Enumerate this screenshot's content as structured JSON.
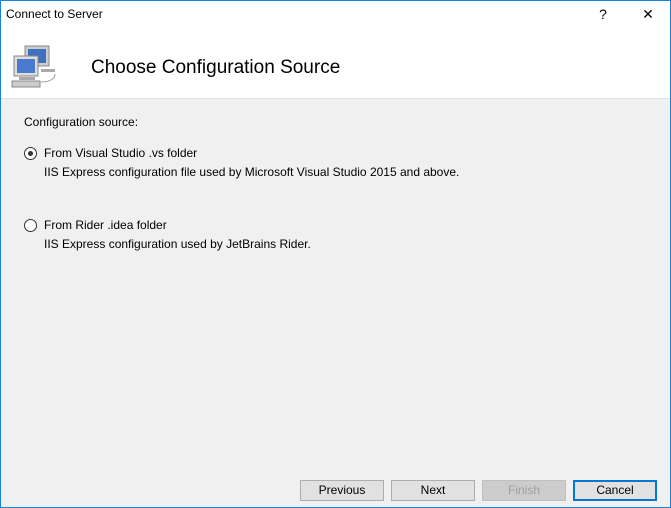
{
  "window": {
    "title": "Connect to Server",
    "help": "?",
    "close": "✕"
  },
  "header": {
    "title": "Choose Configuration Source"
  },
  "body": {
    "label": "Configuration source:",
    "options": [
      {
        "label": "From Visual Studio .vs folder",
        "description": "IIS Express configuration file used by Microsoft Visual Studio 2015 and above.",
        "selected": true
      },
      {
        "label": "From Rider .idea folder",
        "description": "IIS Express configuration used by JetBrains Rider.",
        "selected": false
      }
    ]
  },
  "buttons": {
    "previous": "Previous",
    "next": "Next",
    "finish": "Finish",
    "cancel": "Cancel"
  }
}
